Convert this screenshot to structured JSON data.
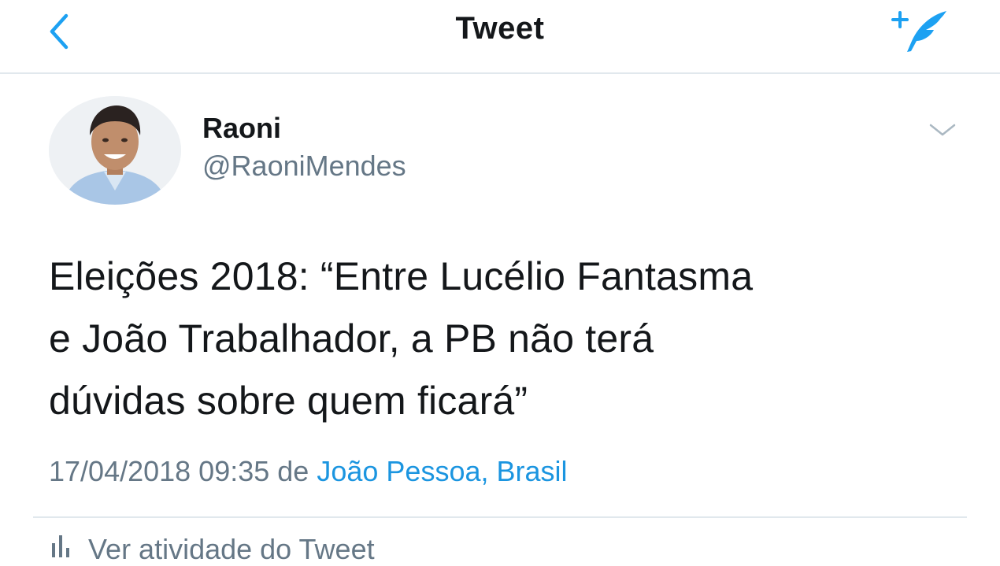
{
  "navbar": {
    "title": "Tweet",
    "back_icon": "chevron-left-icon",
    "compose_icon": "compose-tweet-icon",
    "accent": "#1da1f2"
  },
  "author": {
    "name": "Raoni",
    "handle": "@RaoniMendes"
  },
  "tweet": {
    "text_lines": [
      "Eleições 2018: “Entre Lucélio Fantasma",
      "e João Trabalhador, a PB não terá",
      "dúvidas sobre quem ficará”"
    ],
    "timestamp": "17/04/2018 09:35",
    "from_word": "de",
    "location": "João Pessoa, Brasil"
  },
  "activity": {
    "label": "Ver atividade do Tweet"
  },
  "colors": {
    "link": "#1b95e0",
    "secondary_text": "#657786",
    "divider": "#e1e8ed"
  }
}
